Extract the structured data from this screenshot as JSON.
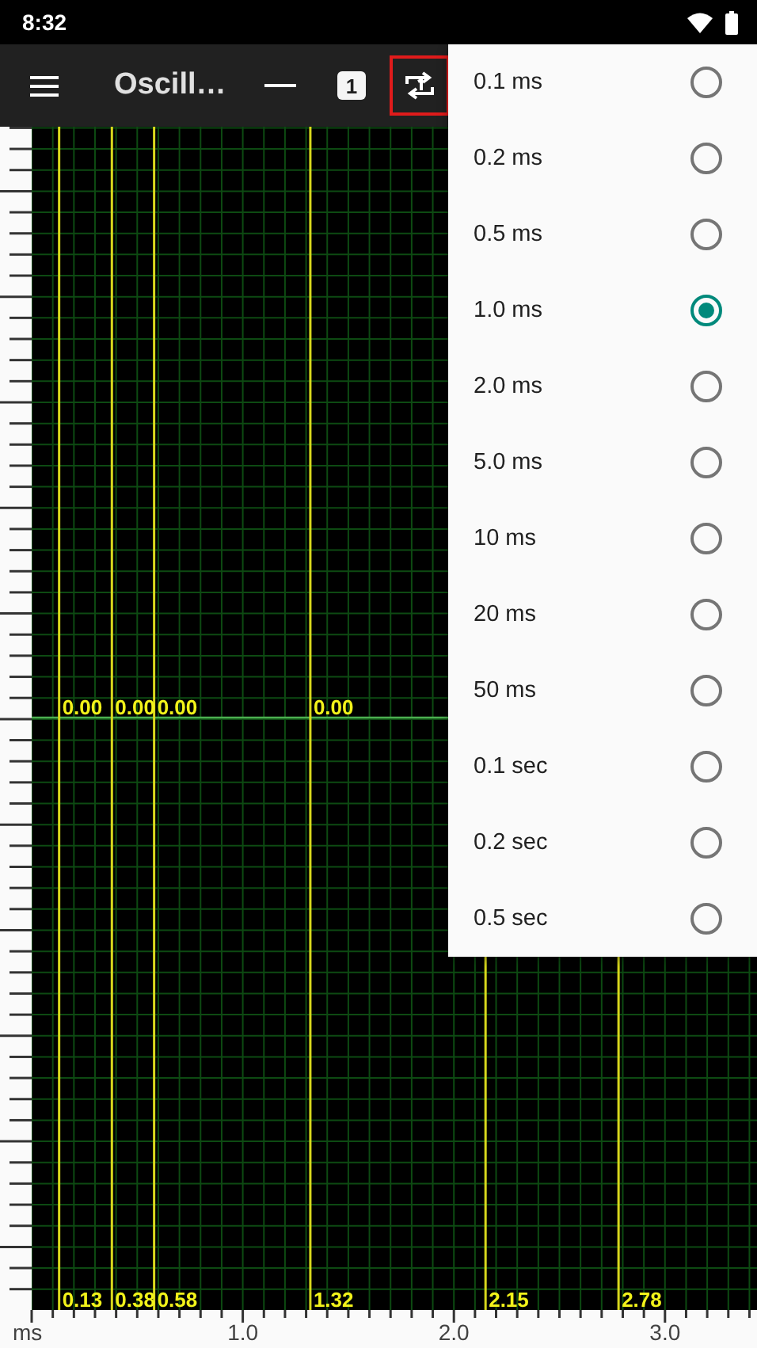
{
  "status_bar": {
    "time": "8:32"
  },
  "toolbar": {
    "title": "Oscill…",
    "channel": "1",
    "trigger_highlighted": true
  },
  "plot": {
    "x_axis_unit": "ms",
    "x_axis_labels": [
      "1.0",
      "2.0",
      "3.0"
    ],
    "cursors": [
      {
        "time": "0.13",
        "value": "0.00"
      },
      {
        "time": "0.38",
        "value": "0.00"
      },
      {
        "time": "0.58",
        "value": "0.00"
      },
      {
        "time": "1.32",
        "value": "0.00"
      },
      {
        "time": "2.15"
      },
      {
        "time": "2.78"
      }
    ]
  },
  "timebase_menu": {
    "options": [
      {
        "label": "0.1 ms",
        "selected": false
      },
      {
        "label": "0.2 ms",
        "selected": false
      },
      {
        "label": "0.5 ms",
        "selected": false
      },
      {
        "label": "1.0 ms",
        "selected": true
      },
      {
        "label": "2.0 ms",
        "selected": false
      },
      {
        "label": "5.0 ms",
        "selected": false
      },
      {
        "label": "10 ms",
        "selected": false
      },
      {
        "label": "20 ms",
        "selected": false
      },
      {
        "label": "50 ms",
        "selected": false
      },
      {
        "label": "0.1 sec",
        "selected": false
      },
      {
        "label": "0.2 sec",
        "selected": false
      },
      {
        "label": "0.5 sec",
        "selected": false
      }
    ]
  }
}
